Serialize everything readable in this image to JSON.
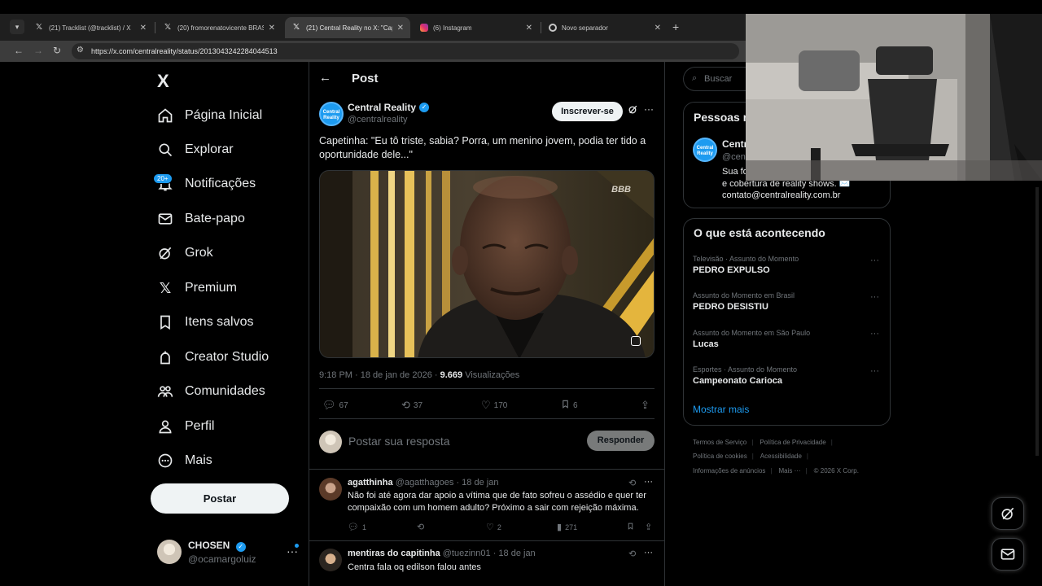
{
  "browser": {
    "tabs": [
      {
        "title": "(21) Tracklist (@tracklist) / X",
        "favicon": "x-logo",
        "active": false
      },
      {
        "title": "(20) fromorenatovicente BRASIL",
        "favicon": "x-logo",
        "active": false
      },
      {
        "title": "(21) Central Reality no X: \"Capetinha",
        "favicon": "x-logo",
        "active": true
      },
      {
        "title": "(6) Instagram",
        "favicon": "instagram-logo",
        "active": false
      },
      {
        "title": "Novo separador",
        "favicon": "chrome-logo",
        "active": false
      }
    ],
    "url": "https://x.com/centralreality/status/2013043242284044513"
  },
  "nav": {
    "logo": "X",
    "items": [
      {
        "label": "Página Inicial",
        "icon": "home-icon"
      },
      {
        "label": "Explorar",
        "icon": "search-icon"
      },
      {
        "label": "Notificações",
        "icon": "bell-icon"
      },
      {
        "label": "Bate-papo",
        "icon": "mail-icon"
      },
      {
        "label": "Grok",
        "icon": "grok-icon"
      },
      {
        "label": "Premium",
        "icon": "x-premium-icon"
      },
      {
        "label": "Itens salvos",
        "icon": "bookmark-icon"
      },
      {
        "label": "Creator Studio",
        "icon": "creator-studio-icon"
      },
      {
        "label": "Comunidades",
        "icon": "communities-icon"
      },
      {
        "label": "Perfil",
        "icon": "person-icon"
      },
      {
        "label": "Mais",
        "icon": "more-circle-icon"
      }
    ],
    "notifications_badge": "20+",
    "post_button": "Postar",
    "account": {
      "name": "CHOSEN",
      "handle": "@ocamargoluiz"
    }
  },
  "post": {
    "header": "Post",
    "author": {
      "name": "Central Reality",
      "handle": "@centralreality",
      "avatar_text": "Central Reality"
    },
    "subscribe_label": "Inscrever-se",
    "text": "Capetinha: \"Eu tô triste, sabia? Porra, um menino jovem, podia ter tido a oportunidade dele...\"",
    "media_watermark": "BBB",
    "time": "9:18 PM · 18 de jan de 2026 · ",
    "views_count": "9.669",
    "views_label": " Visualizações",
    "actions": {
      "replies": "67",
      "reposts": "37",
      "likes": "170",
      "bookmarks": "6"
    },
    "reply_placeholder": "Postar sua resposta",
    "reply_button": "Responder"
  },
  "comments": [
    {
      "name": "agatthinha",
      "handle": "@agatthagoes · 18 de jan",
      "text": "Não foi até agora dar apoio a vítima que de fato sofreu o assédio e quer ter compaixão com um homem adulto? Próximo a sair com rejeição máxima.",
      "replies": "1",
      "likes": "2",
      "views": "271"
    },
    {
      "name": "mentiras do capitinha",
      "handle": "@tuezinn01 · 18 de jan",
      "text": "Centra fala oq edilson falou antes"
    }
  ],
  "sidebar": {
    "search_placeholder": "Buscar",
    "who_to_follow": {
      "title_visible": "Pessoas r",
      "name_visible": "Centra",
      "handle_visible": "@cen",
      "bio_visible": "Sua fo\ne cobertura de reality shows. ✉️\ncontato@centralreality.com.br"
    },
    "trending": {
      "title": "O que está acontecendo",
      "items": [
        {
          "context": "Televisão · Assunto do Momento",
          "name": "PEDRO EXPULSO"
        },
        {
          "context": "Assunto do Momento em Brasil",
          "name": "PEDRO DESISTIU"
        },
        {
          "context": "Assunto do Momento em São Paulo",
          "name": "Lucas"
        },
        {
          "context": "Esportes · Assunto do Momento",
          "name": "Campeonato Carioca"
        }
      ],
      "show_more": "Mostrar mais"
    },
    "footer": {
      "line1": [
        "Termos de Serviço",
        "Política de Privacidade"
      ],
      "line2": [
        "Política de cookies",
        "Acessibilidade"
      ],
      "line3": [
        "Informações de anúncios",
        "Mais ···",
        "© 2026 X Corp."
      ]
    }
  },
  "colors": {
    "accent": "#1d9bf0",
    "background": "#000000",
    "border": "#2f3336",
    "muted_text": "#71767b"
  }
}
